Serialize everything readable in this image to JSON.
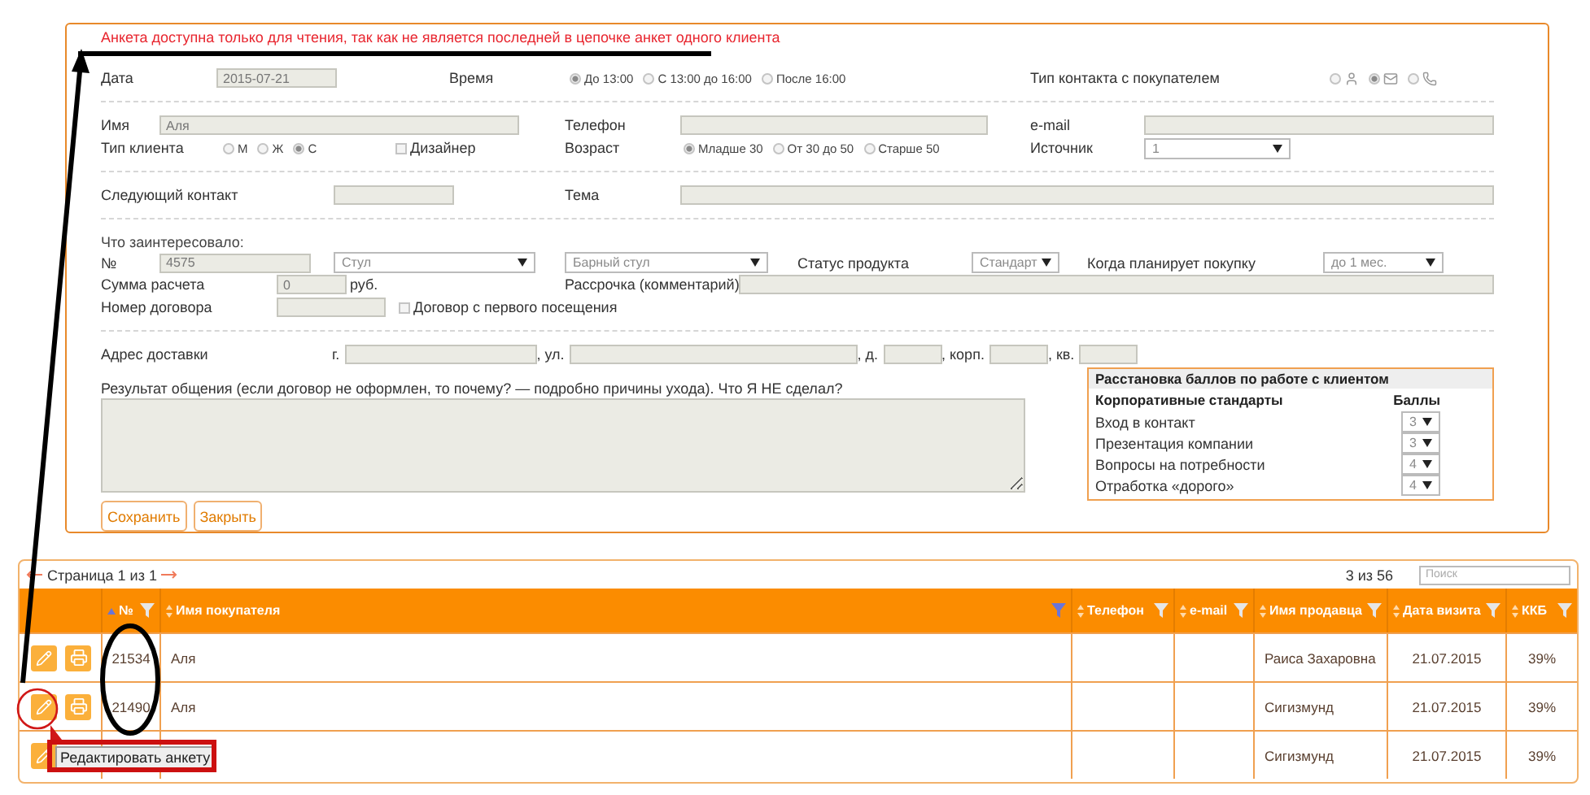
{
  "notice": "Анкета доступна только для чтения, так как не является последней в цепочке анкет одного клиента",
  "form": {
    "date": {
      "label": "Дата",
      "value": "2015-07-21"
    },
    "time": {
      "label": "Время",
      "options": [
        {
          "label": "До 13:00",
          "selected": true
        },
        {
          "label": "С 13:00 до 16:00",
          "selected": false
        },
        {
          "label": "После 16:00",
          "selected": false
        }
      ]
    },
    "contact_type": {
      "label": "Тип контакта с покупателем",
      "options": [
        {
          "kind": "person",
          "selected": false
        },
        {
          "kind": "mail",
          "selected": true
        },
        {
          "kind": "phone",
          "selected": false
        }
      ]
    },
    "name": {
      "label": "Имя",
      "value": "Аля"
    },
    "phone": {
      "label": "Телефон"
    },
    "email": {
      "label": "e-mail"
    },
    "client_type": {
      "label": "Тип клиента",
      "options": [
        {
          "label": "М",
          "selected": false
        },
        {
          "label": "Ж",
          "selected": false
        },
        {
          "label": "С",
          "selected": true
        }
      ]
    },
    "designer": {
      "label": "Дизайнер",
      "checked": false
    },
    "age": {
      "label": "Возраст",
      "options": [
        {
          "label": "Младше 30",
          "selected": true
        },
        {
          "label": "От 30 до 50",
          "selected": false
        },
        {
          "label": "Старше 50",
          "selected": false
        }
      ]
    },
    "source": {
      "label": "Источник",
      "value": "1"
    },
    "next_contact": {
      "label": "Следующий контакт"
    },
    "topic": {
      "label": "Тема"
    },
    "interest_heading": "Что заинтересовало:",
    "number": {
      "label": "№",
      "value": "4575"
    },
    "product_type": {
      "value": "Стул"
    },
    "product_model": {
      "value": "Барный стул"
    },
    "product_status": {
      "label": "Статус продукта",
      "value": "Стандарт"
    },
    "purchase_plan": {
      "label": "Когда планирует покупку",
      "value": "до 1 мес."
    },
    "amount": {
      "label": "Сумма расчета",
      "value": "0",
      "unit": "руб."
    },
    "installment": {
      "label": "Рассрочка (комментарий)"
    },
    "contract": {
      "label": "Номер договора"
    },
    "first_visit_contract": {
      "label": "Договор с первого посещения",
      "checked": false
    },
    "address": {
      "label": "Адрес доставки",
      "parts": [
        "г.",
        ", ул.",
        ", д.",
        ", корп.",
        ", кв."
      ]
    },
    "result": {
      "label": "Результат общения (если договор не оформлен, то почему? — подробно причины ухода). Что Я НЕ сделал?"
    },
    "buttons": [
      "Сохранить",
      "Закрыть"
    ],
    "scores": {
      "title": "Расстановка баллов по работе с клиентом",
      "column_1": "Корпоративные стандарты",
      "column_2": "Баллы",
      "rows": [
        {
          "label": "Вход в контакт",
          "value": "3"
        },
        {
          "label": "Презентация компании",
          "value": "3"
        },
        {
          "label": "Вопросы на потребности",
          "value": "4"
        },
        {
          "label": "Отработка «дорого»",
          "value": "4"
        }
      ]
    }
  },
  "table": {
    "pager": "Страница 1 из 1",
    "count": "3 из 56",
    "search": {
      "placeholder": "Поиск"
    },
    "columns": [
      {
        "label": "№",
        "sorted": true,
        "filtered": false
      },
      {
        "label": "Имя покупателя",
        "sorted": false,
        "filtered": true
      },
      {
        "label": "Телефон",
        "sorted": false,
        "filtered": false
      },
      {
        "label": "e-mail",
        "sorted": false,
        "filtered": false
      },
      {
        "label": "Имя продавца",
        "sorted": false,
        "filtered": false
      },
      {
        "label": "Дата визита",
        "sorted": false,
        "filtered": false
      },
      {
        "label": "ККБ",
        "sorted": false,
        "filtered": false
      }
    ],
    "rows": [
      {
        "actions": [
          {
            "kind": "edit"
          },
          {
            "kind": "print"
          }
        ],
        "number": "21534",
        "customer": "Аля",
        "seller": "Раиса Захаровна",
        "date": "21.07.2015",
        "kkb": "39%"
      },
      {
        "actions": [
          {
            "kind": "edit"
          },
          {
            "kind": "print"
          }
        ],
        "number": "21490",
        "customer": "Аля",
        "seller": "Сигизмунд",
        "date": "21.07.2015",
        "kkb": "39%"
      },
      {
        "actions": [
          {
            "kind": "edit"
          }
        ],
        "seller": "Сигизмунд",
        "date": "21.07.2015",
        "kkb": "39%"
      }
    ]
  },
  "tooltip": "Редактировать анкету"
}
